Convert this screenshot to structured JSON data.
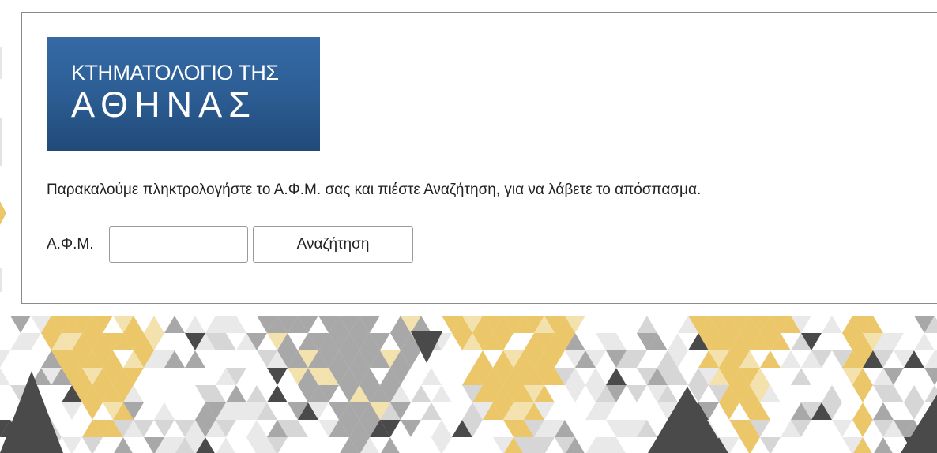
{
  "logo": {
    "line1": "ΚΤΗΜΑΤΟΛΟΓΙΟ ΤΗΣ",
    "line2": "ΑΘΗΝΑΣ",
    "background_color": "#2d5f96"
  },
  "form": {
    "instruction": "Παρακαλούμε πληκτρολογήστε το Α.Φ.Μ. σας και πιέστε Αναζήτηση, για να λάβετε το απόσπασμα.",
    "afm_label": "Α.Φ.Μ.",
    "afm_value": "",
    "search_button_label": "Αναζήτηση"
  },
  "colors": {
    "accent_gold": "#ecc769",
    "pattern_gray": "#a8a8a8",
    "pattern_dark": "#4a4a4a"
  }
}
